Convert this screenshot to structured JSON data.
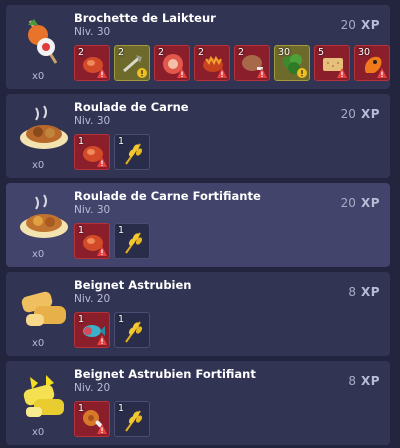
{
  "recipes": [
    {
      "name": "Brochette de Laikteur",
      "level": "Niv. 30",
      "quantity": "x0",
      "xp_value": "20",
      "xp_unit": "XP",
      "ingredients": [
        {
          "count": "2",
          "icon": "meat-red-icon",
          "state": "missing"
        },
        {
          "count": "2",
          "icon": "fish-bone-icon",
          "state": "warning"
        },
        {
          "count": "2",
          "icon": "ham-slice-icon",
          "state": "missing"
        },
        {
          "count": "2",
          "icon": "spiky-meat-icon",
          "state": "missing"
        },
        {
          "count": "2",
          "icon": "drumstick-icon",
          "state": "missing"
        },
        {
          "count": "30",
          "icon": "herb-icon",
          "state": "warning"
        },
        {
          "count": "5",
          "icon": "cracker-icon",
          "state": "missing"
        },
        {
          "count": "30",
          "icon": "orange-creature-icon",
          "state": "missing"
        }
      ]
    },
    {
      "name": "Roulade de Carne",
      "level": "Niv. 30",
      "quantity": "x0",
      "xp_value": "20",
      "xp_unit": "XP",
      "ingredients": [
        {
          "count": "1",
          "icon": "meat-red-icon",
          "state": "missing"
        },
        {
          "count": "1",
          "icon": "wheat-icon",
          "state": "ok"
        }
      ]
    },
    {
      "name": "Roulade de Carne Fortifiante",
      "level": "Niv. 30",
      "quantity": "x0",
      "xp_value": "20",
      "xp_unit": "XP",
      "selected": true,
      "ingredients": [
        {
          "count": "1",
          "icon": "meat-red-icon",
          "state": "missing"
        },
        {
          "count": "1",
          "icon": "wheat-icon",
          "state": "ok"
        }
      ]
    },
    {
      "name": "Beignet Astrubien",
      "level": "Niv. 20",
      "quantity": "x0",
      "xp_value": "8",
      "xp_unit": "XP",
      "ingredients": [
        {
          "count": "1",
          "icon": "fish-icon",
          "state": "missing"
        },
        {
          "count": "1",
          "icon": "wheat-icon",
          "state": "ok"
        }
      ]
    },
    {
      "name": "Beignet Astrubien Fortifiant",
      "level": "Niv. 20",
      "quantity": "x0",
      "xp_value": "8",
      "xp_unit": "XP",
      "ingredients": [
        {
          "count": "1",
          "icon": "chicken-leg-icon",
          "state": "missing"
        },
        {
          "count": "1",
          "icon": "wheat-icon",
          "state": "ok"
        }
      ]
    }
  ]
}
